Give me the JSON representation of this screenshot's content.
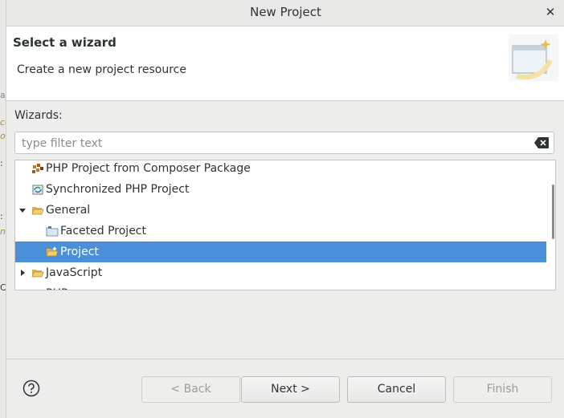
{
  "background": {
    "fragments": [
      "a",
      "co",
      "or",
      ":",
      ":",
      "ne",
      "C"
    ]
  },
  "dialog": {
    "title": "New Project",
    "close_icon": "close-icon"
  },
  "header": {
    "title": "Select a wizard",
    "description": "Create a new project resource",
    "image_icon": "new-project-wizard-icon"
  },
  "wizards_label": "Wizards:",
  "filter": {
    "placeholder": "type filter text",
    "value": "",
    "clear_icon": "clear-text-icon"
  },
  "tree": {
    "items": [
      {
        "label": "PHP Project from Composer Package",
        "icon": "composer-icon",
        "level": 1,
        "expander": "none",
        "selected": false
      },
      {
        "label": "Synchronized PHP Project",
        "icon": "sync-project-icon",
        "level": 1,
        "expander": "none",
        "selected": false
      },
      {
        "label": "General",
        "icon": "folder-open-icon",
        "level": 1,
        "expander": "expanded",
        "selected": false
      },
      {
        "label": "Faceted Project",
        "icon": "faceted-project-icon",
        "level": 2,
        "expander": "none",
        "selected": false
      },
      {
        "label": "Project",
        "icon": "project-folder-icon",
        "level": 2,
        "expander": "none",
        "selected": true
      },
      {
        "label": "JavaScript",
        "icon": "folder-icon",
        "level": 1,
        "expander": "collapsed",
        "selected": false
      },
      {
        "label": "PHP",
        "icon": "folder-icon",
        "level": 1,
        "expander": "collapsed",
        "selected": false
      }
    ]
  },
  "buttons": {
    "help_icon": "help-icon",
    "back": {
      "label": "< Back",
      "enabled": false
    },
    "next": {
      "label": "Next >",
      "enabled": true
    },
    "cancel": {
      "label": "Cancel",
      "enabled": true
    },
    "finish": {
      "label": "Finish",
      "enabled": false
    }
  },
  "colors": {
    "selection": "#4a90d9",
    "dialog_bg": "#ededec",
    "header_bg": "#ffffff"
  }
}
